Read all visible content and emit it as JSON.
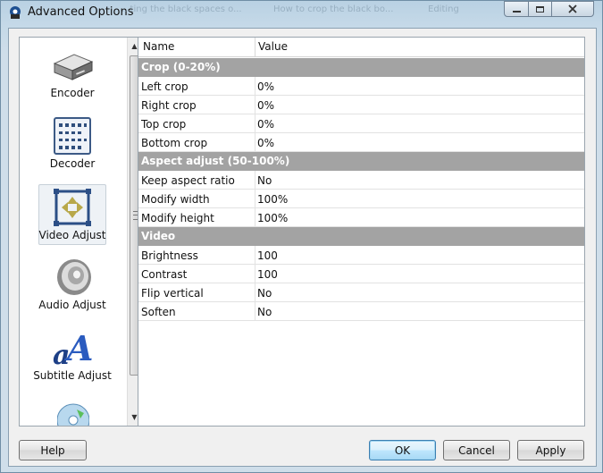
{
  "window": {
    "title": "Advanced Options"
  },
  "background_tabs": [
    "...ting the black spaces o...",
    "How to crop the black bo...",
    "Editing"
  ],
  "categories": [
    {
      "label": "Encoder",
      "icon": "hard-drive-icon",
      "selected": false
    },
    {
      "label": "Decoder",
      "icon": "chip-board-icon",
      "selected": false
    },
    {
      "label": "Video Adjust",
      "icon": "video-adjust-icon",
      "selected": true
    },
    {
      "label": "Audio Adjust",
      "icon": "speaker-icon",
      "selected": false
    },
    {
      "label": "Subtitle Adjust",
      "icon": "subtitle-letters-icon",
      "selected": false
    }
  ],
  "grid": {
    "col_name": "Name",
    "col_value": "Value",
    "sections": [
      {
        "title": "Crop (0-20%)",
        "rows": [
          {
            "name": "Left crop",
            "value": "0%"
          },
          {
            "name": "Right crop",
            "value": "0%"
          },
          {
            "name": "Top crop",
            "value": "0%"
          },
          {
            "name": "Bottom crop",
            "value": "0%"
          }
        ]
      },
      {
        "title": "Aspect adjust (50-100%)",
        "rows": [
          {
            "name": "Keep aspect ratio",
            "value": "No"
          },
          {
            "name": "Modify width",
            "value": "100%"
          },
          {
            "name": "Modify height",
            "value": "100%"
          }
        ]
      },
      {
        "title": "Video",
        "rows": [
          {
            "name": "Brightness",
            "value": "100"
          },
          {
            "name": "Contrast",
            "value": "100"
          },
          {
            "name": "Flip vertical",
            "value": "No"
          },
          {
            "name": "Soften",
            "value": "No"
          }
        ]
      }
    ]
  },
  "buttons": {
    "help": "Help",
    "ok": "OK",
    "cancel": "Cancel",
    "apply": "Apply"
  }
}
